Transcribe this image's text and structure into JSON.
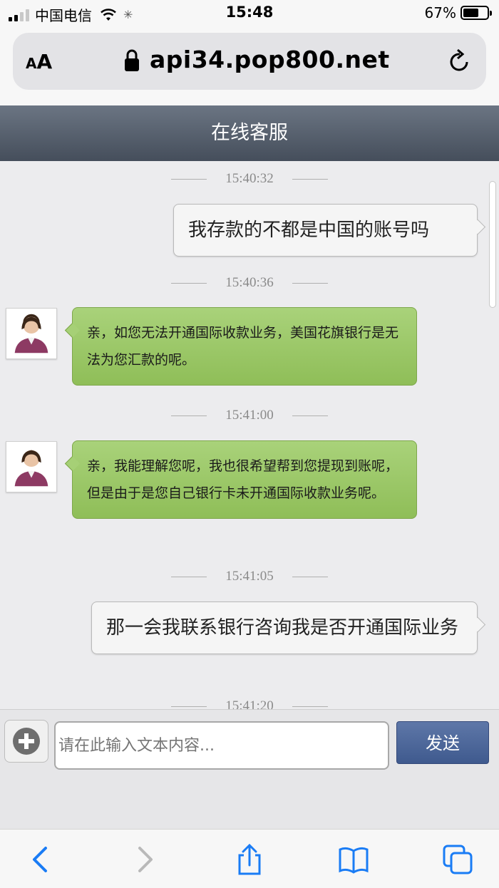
{
  "status_bar": {
    "carrier": "中国电信",
    "time": "15:48",
    "battery_percent": "67%",
    "battery_level": 0.67
  },
  "browser": {
    "text_size_label": "AA",
    "url": "api34.pop800.net"
  },
  "header": {
    "title": "在线客服"
  },
  "messages": [
    {
      "timestamp": "15:40:32",
      "side": "right",
      "text": "我存款的不都是中国的账号吗"
    },
    {
      "timestamp": "15:40:36",
      "side": "left",
      "text": "亲，如您无法开通国际收款业务，美国花旗银行是无法为您汇款的呢。"
    },
    {
      "timestamp": "15:41:00",
      "side": "left",
      "text": "亲，我能理解您呢，我也很希望帮到您提现到账呢，但是由于是您自己银行卡未开通国际收款业务呢。"
    },
    {
      "timestamp": "15:41:05",
      "side": "right",
      "text": "那一会我联系银行咨询我是否开通国际业务"
    },
    {
      "timestamp": "15:41:20"
    }
  ],
  "input": {
    "placeholder": "请在此输入文本内容...",
    "send_label": "发送"
  },
  "icons": {
    "add": "plus-circle-icon",
    "back": "chevron-left-icon",
    "forward": "chevron-right-icon",
    "share": "share-icon",
    "bookmarks": "book-icon",
    "tabs": "tabs-icon"
  },
  "colors": {
    "header_bg": "#555e6b",
    "agent_bubble": "#9ccb67",
    "send_button": "#4c66a0",
    "ios_blue": "#1a7cf5"
  }
}
